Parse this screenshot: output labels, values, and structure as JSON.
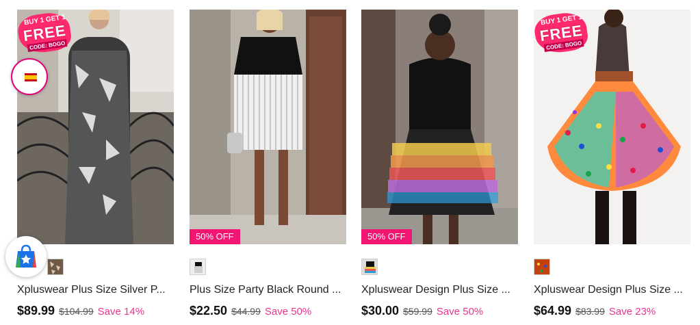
{
  "products": [
    {
      "title": "Xpluswear Plus Size Silver P...",
      "price": "$89.99",
      "original_price": "$104.99",
      "save": "Save 14%",
      "promo": {
        "line1": "BUY 1 GET 1",
        "line2": "FREE",
        "line3": "CODE: BOGO"
      },
      "discount_badge": ""
    },
    {
      "title": "Plus Size Party Black Round ...",
      "price": "$22.50",
      "original_price": "$44.99",
      "save": "Save 50%",
      "discount_badge": "50% OFF"
    },
    {
      "title": "Xpluswear Design Plus Size ...",
      "price": "$30.00",
      "original_price": "$59.99",
      "save": "Save 50%",
      "discount_badge": "50% OFF"
    },
    {
      "title": "Xpluswear Design Plus Size ...",
      "price": "$64.99",
      "original_price": "$83.99",
      "save": "Save 23%",
      "promo": {
        "line1": "BUY 1 GET 1",
        "line2": "FREE",
        "line3": "CODE: BOGO"
      },
      "discount_badge": ""
    }
  ],
  "floating": {
    "flag_icon": "spain-flag-icon",
    "bag_icon": "shopping-bag-star-icon"
  },
  "colors": {
    "accent_pink": "#f21572",
    "save_pink": "#e8338f",
    "promo_pink": "#ff2a6e"
  }
}
